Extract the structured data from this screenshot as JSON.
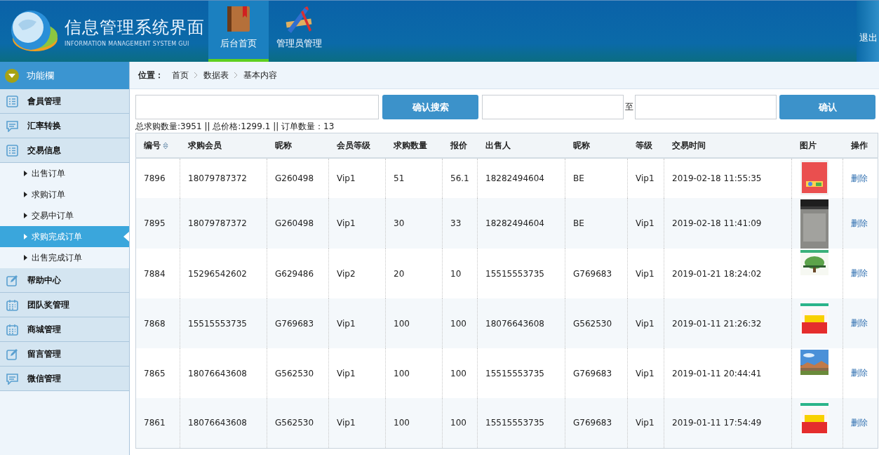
{
  "header": {
    "title": "信息管理系统界面",
    "subtitle": "INFORMATION MANAGEMENT SYSTEM GUI",
    "logout": "退出",
    "tabs": [
      {
        "label": "后台首页",
        "selected": true
      },
      {
        "label": "管理员管理",
        "selected": false
      }
    ]
  },
  "sidebar": {
    "title": "功能欄",
    "items": [
      {
        "label": "會員管理"
      },
      {
        "label": "汇率转换"
      },
      {
        "label": "交易信息",
        "children": [
          {
            "label": "出售订单",
            "selected": false
          },
          {
            "label": "求购订单",
            "selected": false
          },
          {
            "label": "交易中订单",
            "selected": false
          },
          {
            "label": "求购完成订单",
            "selected": true
          },
          {
            "label": "出售完成订单",
            "selected": false
          }
        ]
      },
      {
        "label": "帮助中心"
      },
      {
        "label": "团队奖管理"
      },
      {
        "label": "商城管理"
      },
      {
        "label": "留言管理"
      },
      {
        "label": "微信管理"
      }
    ]
  },
  "breadcrumb": {
    "label": "位置：",
    "items": [
      "首页",
      "数据表",
      "基本内容"
    ]
  },
  "search": {
    "button": "确认搜索",
    "range_separator": "至",
    "confirm_button": "确认"
  },
  "summary": "总求购数量:3951 || 总价格:1299.1 || 订单数量：13",
  "table": {
    "columns": [
      "编号",
      "求购会员",
      "昵称",
      "会员等级",
      "求购数量",
      "报价",
      "出售人",
      "昵称",
      "等级",
      "交易时间",
      "图片",
      "操作"
    ],
    "rows": [
      {
        "cells": [
          "7896",
          "18079787372",
          "G260498",
          "Vip1",
          "51",
          "56.1",
          "18282494604",
          "BE",
          "Vip1",
          "2019-02-18 11:55:35"
        ],
        "action": "删除"
      },
      {
        "cells": [
          "7895",
          "18079787372",
          "G260498",
          "Vip1",
          "30",
          "33",
          "18282494604",
          "BE",
          "Vip1",
          "2019-02-18 11:41:09"
        ],
        "action": "删除"
      },
      {
        "cells": [
          "7884",
          "15296542602",
          "G629486",
          "Vip2",
          "20",
          "10",
          "15515553735",
          "G769683",
          "Vip1",
          "2019-01-21 18:24:02"
        ],
        "action": "删除"
      },
      {
        "cells": [
          "7868",
          "15515553735",
          "G769683",
          "Vip1",
          "100",
          "100",
          "18076643608",
          "G562530",
          "Vip1",
          "2019-01-11 21:26:32"
        ],
        "action": "删除"
      },
      {
        "cells": [
          "7865",
          "18076643608",
          "G562530",
          "Vip1",
          "100",
          "100",
          "15515553735",
          "G769683",
          "Vip1",
          "2019-01-11 20:44:41"
        ],
        "action": "删除"
      },
      {
        "cells": [
          "7861",
          "18076643608",
          "G562530",
          "Vip1",
          "100",
          "100",
          "15515553735",
          "G769683",
          "Vip1",
          "2019-01-11 17:54:49"
        ],
        "action": "删除"
      }
    ]
  }
}
